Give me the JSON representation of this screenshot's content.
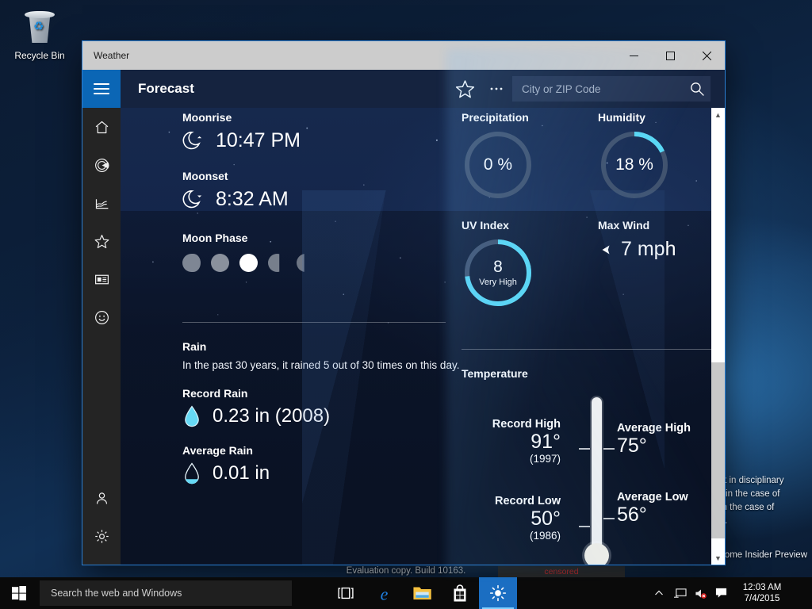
{
  "desktop": {
    "recycle_bin_label": "Recycle Bin",
    "background_text_lines": [
      "esult in disciplinary",
      "ent (in the case of",
      "ct (in the case of",
      "bility."
    ],
    "background_text_2": "Home Insider Preview",
    "eval_watermark": "Evaluation copy. Build 10163.",
    "censored_label": "censored"
  },
  "window": {
    "title": "Weather",
    "minimize_label": "–",
    "maximize_label": "□",
    "close_label": "✕"
  },
  "header": {
    "page_title": "Forecast",
    "hamburger_name": "menu",
    "favorite_icon": "star-icon",
    "more_icon": "ellipsis-icon",
    "search_placeholder": "City or ZIP Code",
    "search_value": "",
    "search_icon": "search-icon"
  },
  "rail": {
    "items": [
      {
        "label": "Forecast",
        "icon": "home-icon"
      },
      {
        "label": "Maps",
        "icon": "radar-icon"
      },
      {
        "label": "Historical Weather",
        "icon": "chart-line-icon"
      },
      {
        "label": "Favorites",
        "icon": "star-icon"
      },
      {
        "label": "News",
        "icon": "news-icon"
      },
      {
        "label": "Send Feedback",
        "icon": "smiley-icon"
      }
    ],
    "bottom_items": [
      {
        "label": "Account",
        "icon": "person-icon"
      },
      {
        "label": "Settings",
        "icon": "gear-icon"
      }
    ]
  },
  "astronomy": {
    "moonrise_label": "Moonrise",
    "moonrise_value": "10:47 PM",
    "moonset_label": "Moonset",
    "moonset_value": "8:32 AM",
    "moon_phase_label": "Moon Phase",
    "phases": [
      {
        "name": "waxing-gibbous",
        "state": "dim"
      },
      {
        "name": "waxing-gibbous-2",
        "state": "dim"
      },
      {
        "name": "full-moon",
        "state": "current"
      },
      {
        "name": "waning-gibbous",
        "state": "dim"
      },
      {
        "name": "waning-crescent",
        "state": "dim"
      }
    ]
  },
  "conditions": {
    "precipitation_label": "Precipitation",
    "precipitation_value": "0 %",
    "precipitation_pct": 0,
    "humidity_label": "Humidity",
    "humidity_value": "18 %",
    "humidity_pct": 18,
    "uv_label": "UV Index",
    "uv_value": "8",
    "uv_sub": "Very High",
    "uv_pct": 73,
    "wind_label": "Max Wind",
    "wind_value": "7 mph",
    "wind_icon": "wind-direction-arrow"
  },
  "rain": {
    "section_label": "Rain",
    "description": "In the past 30 years, it rained 5 out of 30 times on this day.",
    "record_label": "Record Rain",
    "record_value": "0.23 in (2008)",
    "average_label": "Average Rain",
    "average_value": "0.01 in"
  },
  "temperature": {
    "section_label": "Temperature",
    "record_high_label": "Record High",
    "record_high_value": "91°",
    "record_high_year": "(1997)",
    "average_high_label": "Average High",
    "average_high_value": "75°",
    "record_low_label": "Record Low",
    "record_low_value": "50°",
    "record_low_year": "(1986)",
    "average_low_label": "Average Low",
    "average_low_value": "56°"
  },
  "taskbar": {
    "start_icon": "windows-logo-icon",
    "search_placeholder": "Search the web and Windows",
    "buttons": [
      {
        "name": "task-view",
        "icon": "task-view-icon"
      },
      {
        "name": "edge",
        "icon": "edge-icon"
      },
      {
        "name": "file-explorer",
        "icon": "folder-icon"
      },
      {
        "name": "store",
        "icon": "store-bag-icon"
      },
      {
        "name": "weather",
        "icon": "weather-sun-icon",
        "active": true
      }
    ],
    "tray": {
      "chevron": "show-hidden-icons-chevron",
      "network": "network-icon",
      "volume": "volume-muted-icon",
      "action_center": "action-center-icon",
      "time": "12:03 AM",
      "date": "7/4/2015"
    }
  },
  "colors": {
    "accent_cyan": "#5ad8f5",
    "gauge_track": "#41536f",
    "window_accent": "#0b66b5",
    "taskbar_active": "#1b6ec2"
  }
}
